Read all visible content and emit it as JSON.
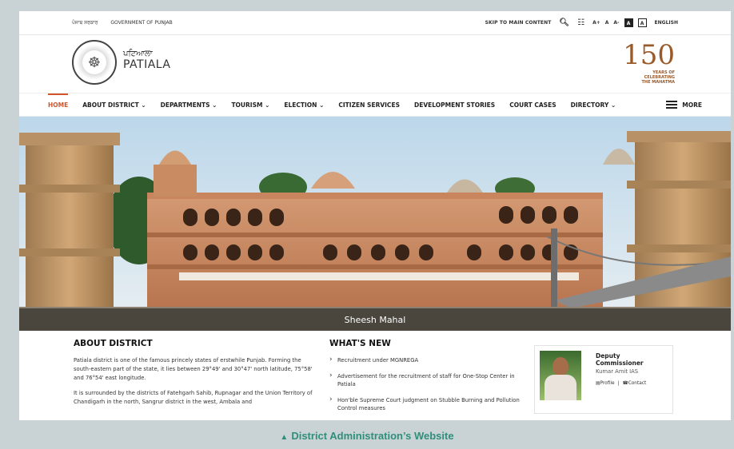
{
  "topbar": {
    "punjabi_gov": "ਪੰਜਾਬ ਸਰਕਾਰ",
    "gov_label": "GOVERNMENT OF PUNJAB",
    "skip": "SKIP TO MAIN CONTENT",
    "font_sizes": [
      "A+",
      "A",
      "A-"
    ],
    "contrast_a": "A",
    "contrast_b": "A",
    "language": "ENGLISH"
  },
  "header": {
    "name_punjabi": "ਪਟਿਆਲਾ",
    "name_english": "PATIALA",
    "mahatma_num": "150",
    "mahatma_l1": "YEARS OF",
    "mahatma_l2": "CELEBRATING",
    "mahatma_l3": "THE MAHATMA"
  },
  "nav": {
    "items": [
      "HOME",
      "ABOUT DISTRICT",
      "DEPARTMENTS",
      "TOURISM",
      "ELECTION",
      "CITIZEN SERVICES",
      "DEVELOPMENT STORIES",
      "COURT CASES",
      "DIRECTORY"
    ],
    "more": "MORE"
  },
  "hero": {
    "caption": "Sheesh Mahal"
  },
  "about": {
    "title": "ABOUT DISTRICT",
    "p1": "Patiala district is one of the famous princely states of erstwhile Punjab. Forming the south-eastern part of the state, it lies between 29°49' and 30°47' north latitude, 75°58' and 76°54' east longitude.",
    "p2": "It is surrounded by the districts of Fatehgarh Sahib, Rupnagar and the Union Territory of Chandigarh in the north, Sangrur district in the west, Ambala and"
  },
  "news": {
    "title": "WHAT'S NEW",
    "items": [
      "Recruitment under MGNREGA",
      "Advertisement for the recruitment of staff for One-Stop Center in Patiala",
      "Hon'ble Supreme Court judgment on Stubble Burning and Pollution Control measures"
    ]
  },
  "dc": {
    "role_l1": "Deputy",
    "role_l2": "Commissioner",
    "person": "Kumar Amit IAS",
    "profile": "Profile",
    "contact": "Contact"
  },
  "figure_caption": "District Administration’s Website",
  "colors": {
    "accent": "#d2542b",
    "caption_teal": "#2f8f7a",
    "mahatma": "#9a5a2a"
  }
}
